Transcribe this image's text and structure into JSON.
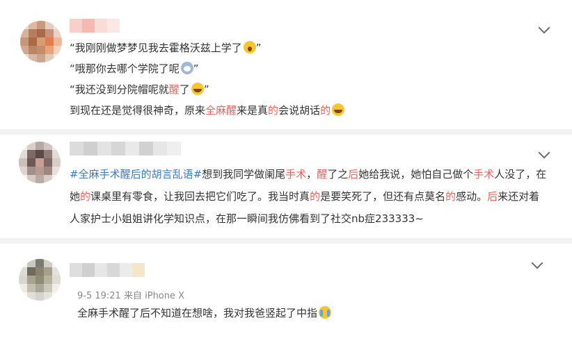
{
  "comments": [
    {
      "lines": [
        [
          "“我刚刚做梦梦见我去霍格沃兹上学了",
          "”"
        ],
        [
          "“哦那你去哪个学院了呢",
          "”"
        ],
        [
          "“我还没到分院帽呢就",
          "醒",
          "了",
          "”"
        ],
        [
          "到现在还是觉得很神奇，原来",
          "全麻醒",
          "来是真",
          "的",
          "会说胡话",
          "的"
        ]
      ],
      "emojis": [
        "scream-emoji",
        "sweat-emoji",
        "laugh-emoji",
        "laugh-emoji"
      ]
    },
    {
      "hashtag": "#全麻手术醒后的胡言乱语#",
      "segments": [
        "想到我同学做阑尾",
        "手术",
        "，",
        "醒",
        "了之",
        "后",
        "她给我说，她怕自己做个",
        "手术",
        "人没了，在她",
        "的",
        "课桌里有零食，让我回去把它们吃了。我当时真",
        "的",
        "是要笑死了，但还有点莫名",
        "的",
        "感动。",
        "后",
        "来还对着人家护士小姐姐讲化学知识点，在那一瞬间我仿佛看到了社交nb症233333~"
      ]
    },
    {
      "timestamp": "9-5 19:21",
      "device": "来自 iPhone X",
      "body": "全麻手术醒了后不知道在想啥，我对我爸竖起了中指",
      "emoji": "cry-emoji"
    }
  ],
  "colors": {
    "accent_red": "#f0615c",
    "hashtag_blue": "#3e78c6",
    "text": "#333333",
    "meta": "#888888",
    "separator": "#f2f2f2"
  }
}
